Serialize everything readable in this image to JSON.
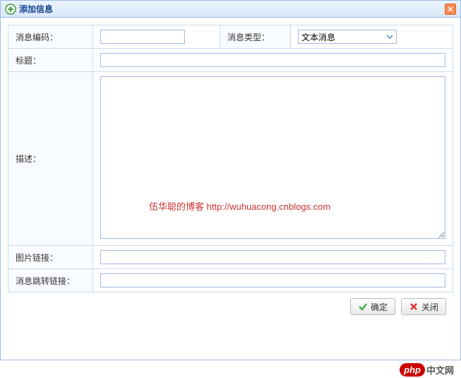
{
  "dialog": {
    "title": "添加信息",
    "close_aria": "close"
  },
  "form": {
    "message_code": {
      "label": "消息编码：",
      "value": ""
    },
    "message_type": {
      "label": "消息类型：",
      "selected": "文本消息"
    },
    "title": {
      "label": "标题：",
      "value": ""
    },
    "description": {
      "label": "描述：",
      "value": ""
    },
    "image_link": {
      "label": "图片链接：",
      "value": ""
    },
    "jump_link": {
      "label": "消息跳转链接：",
      "value": ""
    }
  },
  "watermark": {
    "text": "伍华聪的博客 http://wuhuacong.cnblogs.com"
  },
  "buttons": {
    "ok": "确定",
    "close": "关闭"
  },
  "footer": {
    "badge": "php",
    "text": "中文网"
  }
}
